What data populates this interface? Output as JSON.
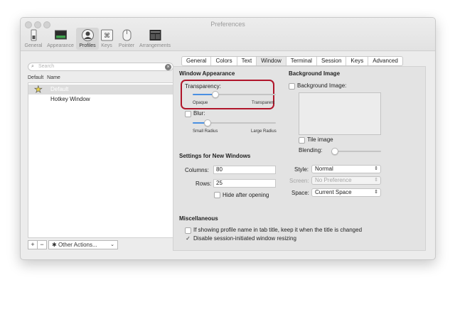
{
  "window": {
    "title": "Preferences"
  },
  "toolbar": {
    "items": [
      {
        "label": "General",
        "icon": "switch-icon"
      },
      {
        "label": "Appearance",
        "icon": "monitor-icon"
      },
      {
        "label": "Profiles",
        "icon": "profile-icon"
      },
      {
        "label": "Keys",
        "icon": "command-key-icon"
      },
      {
        "label": "Pointer",
        "icon": "mouse-icon"
      },
      {
        "label": "Arrangements",
        "icon": "arrangement-icon"
      }
    ],
    "selected": "Profiles"
  },
  "profiles": {
    "search_placeholder": "Search",
    "columns": [
      "Default",
      "Name"
    ],
    "rows": [
      {
        "name": "Default",
        "is_default": true,
        "selected": true
      },
      {
        "name": "Hotkey Window",
        "is_default": false,
        "selected": false
      }
    ],
    "add_label": "+",
    "remove_label": "−",
    "other_actions_label": "Other Actions..."
  },
  "tabs": [
    "General",
    "Colors",
    "Text",
    "Window",
    "Terminal",
    "Session",
    "Keys",
    "Advanced"
  ],
  "active_tab": "Window",
  "window_appearance": {
    "heading": "Window Appearance",
    "transparency_label": "Transparency:",
    "transparency_value": 0.25,
    "opaque_label": "Opaque",
    "transparent_label": "Transparent",
    "blur_label": "Blur:",
    "blur_checked": false,
    "blur_value": 0.15,
    "small_radius_label": "Small Radius",
    "large_radius_label": "Large Radius"
  },
  "background_image": {
    "heading": "Background Image",
    "checkbox_label": "Background Image:",
    "checked": false,
    "tile_label": "Tile image",
    "tile_checked": false,
    "blending_label": "Blending:",
    "blending_value": 0.0
  },
  "new_windows": {
    "heading": "Settings for New Windows",
    "columns_label": "Columns:",
    "columns_value": "80",
    "rows_label": "Rows:",
    "rows_value": "25",
    "hide_label": "Hide after opening",
    "hide_checked": false,
    "style_label": "Style:",
    "style_value": "Normal",
    "screen_label": "Screen:",
    "screen_value": "No Preference",
    "space_label": "Space:",
    "space_value": "Current Space"
  },
  "misc": {
    "heading": "Miscellaneous",
    "opt1_label": "If showing profile name in tab title, keep it when the title is changed",
    "opt1_checked": false,
    "opt2_label": "Disable session-initiated window resizing",
    "opt2_checked": true,
    "check_glyph": "✓"
  },
  "colors": {
    "accent": "#4a90e2",
    "highlight": "#b0152a",
    "star": "#e8d24a"
  }
}
